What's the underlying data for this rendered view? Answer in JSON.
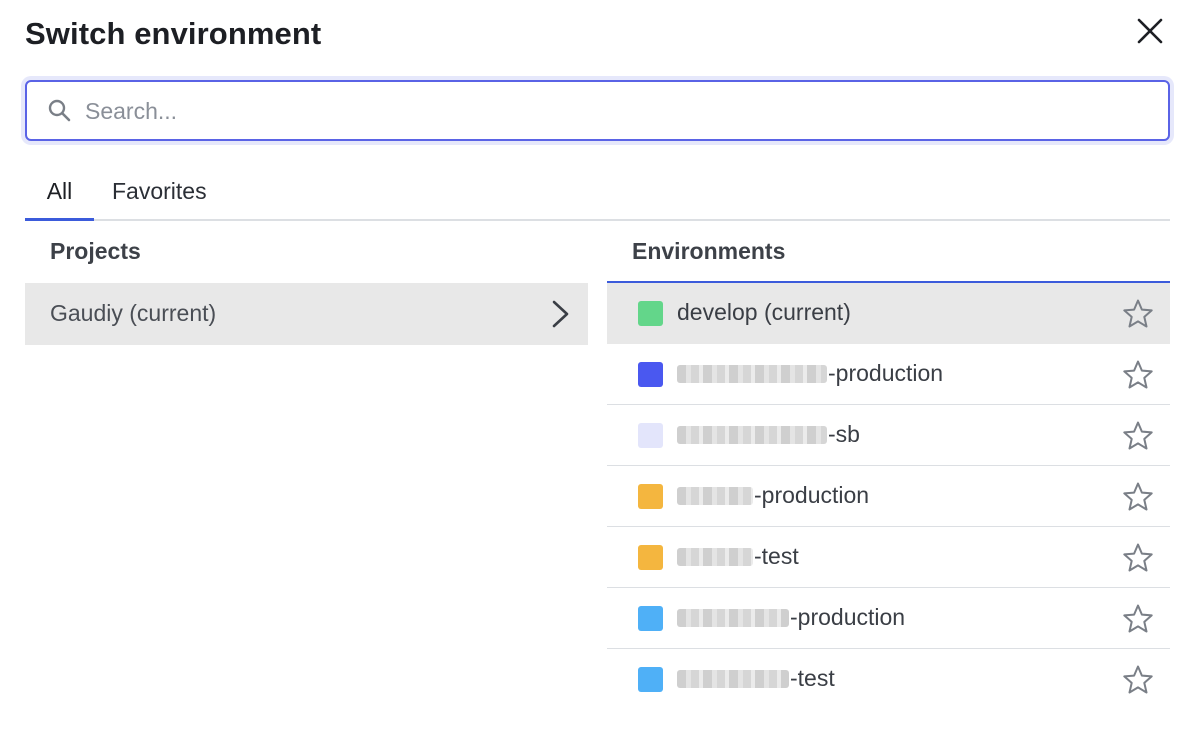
{
  "dialog": {
    "title": "Switch environment"
  },
  "search": {
    "placeholder": "Search...",
    "value": ""
  },
  "tabs": [
    {
      "label": "All",
      "active": true
    },
    {
      "label": "Favorites",
      "active": false
    }
  ],
  "projects": {
    "header": "Projects",
    "items": [
      {
        "label": "Gaudiy (current)"
      }
    ]
  },
  "environments": {
    "header": "Environments",
    "items": [
      {
        "prefix": "",
        "suffix": "develop (current)",
        "color": "#63d68a",
        "current": true
      },
      {
        "prefix": "[redacted]",
        "suffix": "-production",
        "color": "#4a58f0",
        "current": false
      },
      {
        "prefix": "[redacted]",
        "suffix": "-sb",
        "color": "#e3e5fb",
        "current": false
      },
      {
        "prefix": "[redacted]",
        "suffix": "-production",
        "color": "#f4b63f",
        "current": false
      },
      {
        "prefix": "[redacted]",
        "suffix": "-test",
        "color": "#f4b63f",
        "current": false
      },
      {
        "prefix": "[redacted]",
        "suffix": "-production",
        "color": "#4fb0f7",
        "current": false
      },
      {
        "prefix": "[redacted]",
        "suffix": "-test",
        "color": "#4fb0f7",
        "current": false
      }
    ]
  },
  "colors": {
    "accent": "#3b5bdb",
    "row_highlight": "#e8e8e8"
  }
}
